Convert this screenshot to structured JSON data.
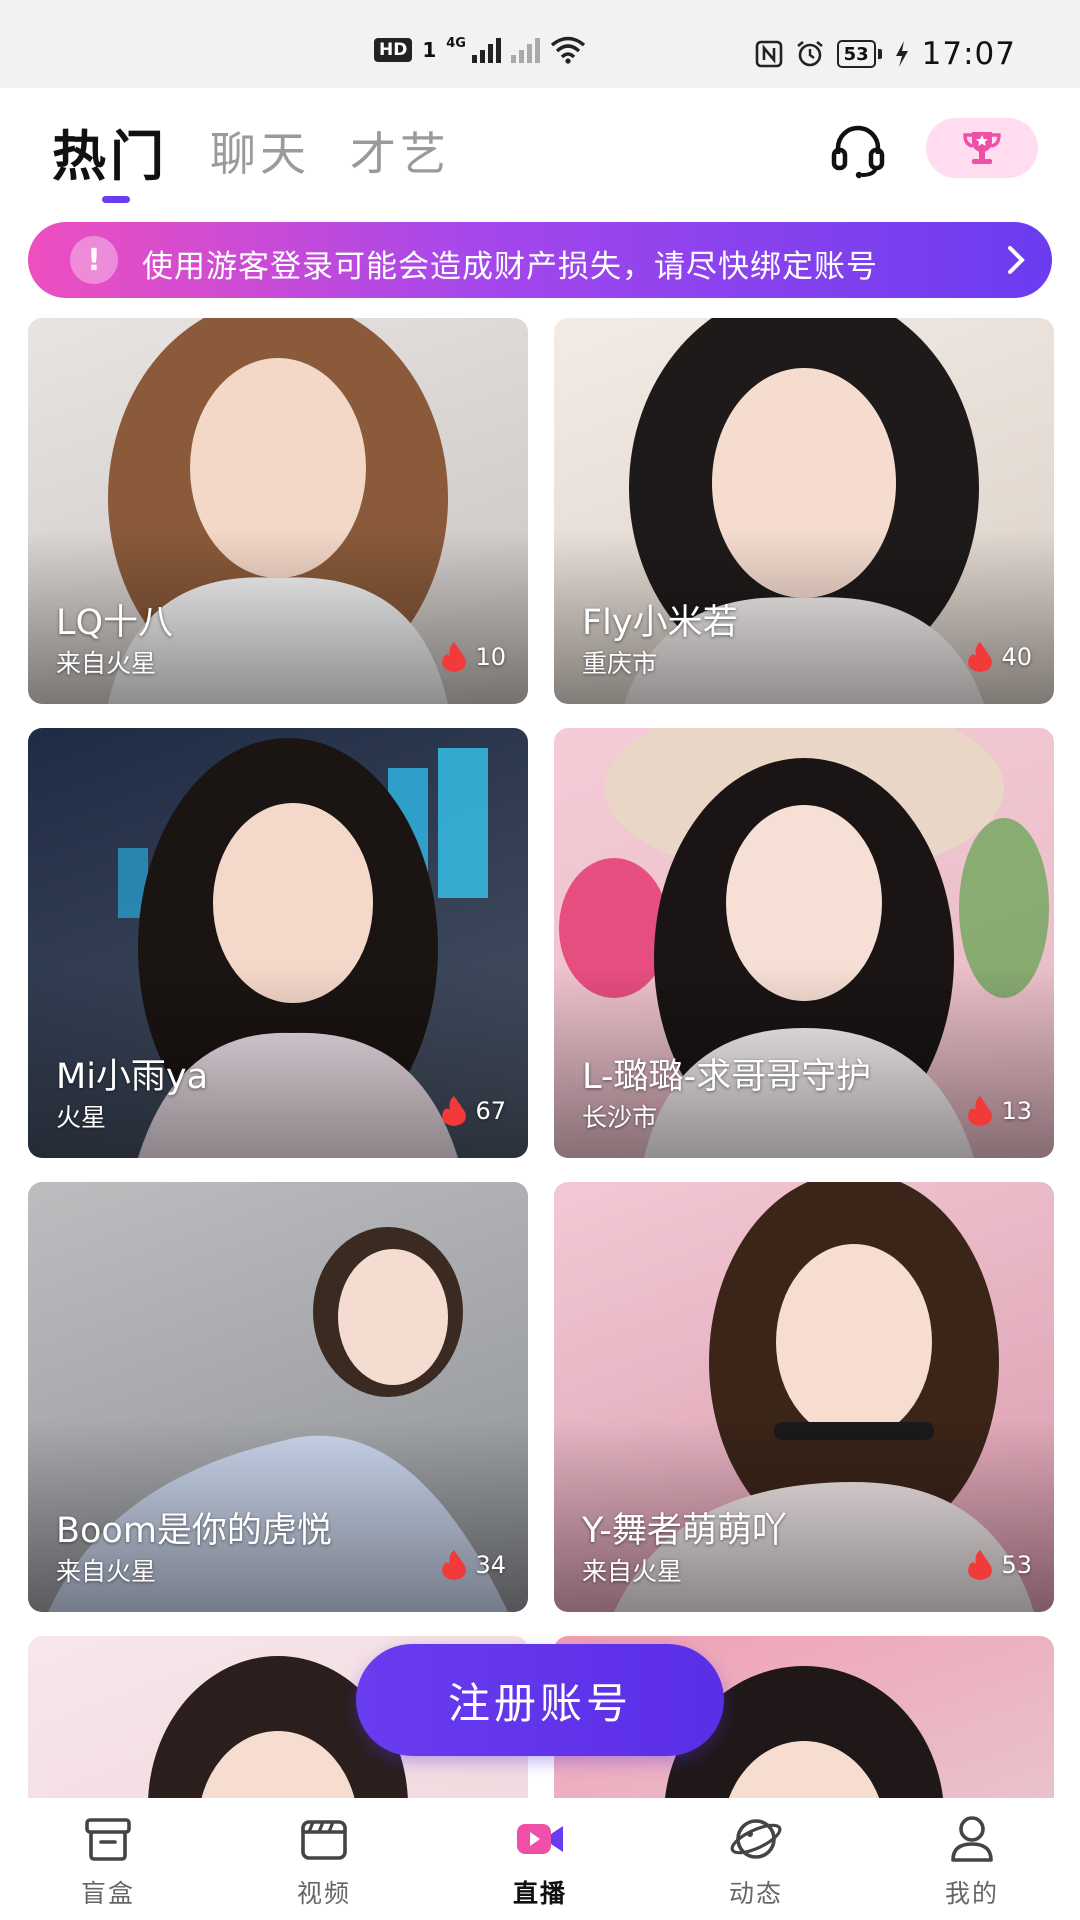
{
  "status_bar": {
    "hd_badge": "HD",
    "sim_slot": "1",
    "net_type": "4G",
    "battery": "53",
    "time": "17:07"
  },
  "header": {
    "tabs": [
      {
        "label": "热门",
        "active": true
      },
      {
        "label": "聊天",
        "active": false
      },
      {
        "label": "才艺",
        "active": false
      }
    ],
    "headset_icon": "headset-icon",
    "trophy_icon": "trophy-icon"
  },
  "notice": {
    "icon": "!",
    "text": "使用游客登录可能会造成财产损失，请尽快绑定账号"
  },
  "cards": [
    {
      "name": "LQ十八",
      "location": "来自火星",
      "heat": "10",
      "bg": [
        "#e8e4e2",
        "#c9c3c0"
      ],
      "hair": "#8a5a3a",
      "shirt": "#f4f4f4"
    },
    {
      "name": "Fly小米若",
      "location": "重庆市",
      "heat": "40",
      "bg": [
        "#f3ebe4",
        "#d9cfc7"
      ],
      "hair": "#1e1a1a",
      "shirt": "#f7f2f2"
    },
    {
      "name": "Mi小雨ya",
      "location": "火星",
      "heat": "67",
      "bg": [
        "#1f2b44",
        "#4b5566"
      ],
      "hair": "#1a1412",
      "shirt": "#efe2ea"
    },
    {
      "name": "L-璐璐-求哥哥守护",
      "location": "长沙市",
      "heat": "13",
      "bg": [
        "#f4cbd6",
        "#e6b9c4"
      ],
      "hair": "#1a1414",
      "shirt": "#faf4f6"
    },
    {
      "name": "Boom是你的虎悦",
      "location": "来自火星",
      "heat": "34",
      "bg": [
        "#bcbdbf",
        "#8e9196"
      ],
      "hair": "#3a2a22",
      "shirt": "#c9d4ea"
    },
    {
      "name": "Y-舞者萌萌吖",
      "location": "来自火星",
      "heat": "53",
      "bg": [
        "#f3c8d4",
        "#d89aac"
      ],
      "hair": "#3b2418",
      "shirt": "#efe6e6"
    },
    {
      "name": "",
      "location": "",
      "heat": "",
      "bg": [
        "#f7e6ea",
        "#f1d9de"
      ],
      "hair": "#2a1f1c",
      "shirt": "#f4eeee"
    },
    {
      "name": "",
      "location": "",
      "heat": "",
      "bg": [
        "#f0a0b4",
        "#e8c6cf"
      ],
      "hair": "#201818",
      "shirt": "#f4eeee"
    }
  ],
  "register_button": {
    "label": "注册账号"
  },
  "bottom_nav": [
    {
      "label": "盲盒",
      "icon": "blind-box-icon",
      "active": false
    },
    {
      "label": "视频",
      "icon": "video-clapper-icon",
      "active": false
    },
    {
      "label": "直播",
      "icon": "live-camera-icon",
      "active": true
    },
    {
      "label": "动态",
      "icon": "planet-icon",
      "active": false
    },
    {
      "label": "我的",
      "icon": "user-icon",
      "active": false
    }
  ],
  "colors": {
    "accent": "#6a3cf0",
    "banner_start": "#ee4fbf",
    "banner_end": "#6a3cf0",
    "trophy_bg": "#ffdcf0",
    "heat_flame": "#f23a3a"
  }
}
